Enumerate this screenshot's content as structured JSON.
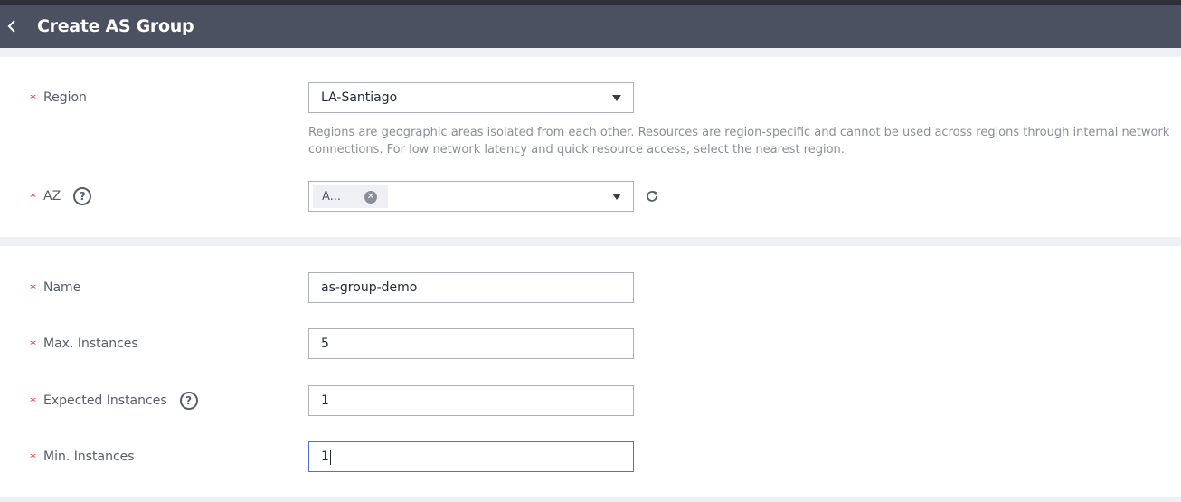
{
  "header": {
    "title": "Create AS Group"
  },
  "region": {
    "label": "Region",
    "value": "LA-Santiago",
    "hint": "Regions are geographic areas isolated from each other. Resources are region-specific and cannot be used across regions through internal network connections. For low network latency and quick resource access, select the nearest region."
  },
  "az": {
    "label": "AZ",
    "tag": "A..."
  },
  "name": {
    "label": "Name",
    "value": "as-group-demo"
  },
  "max_instances": {
    "label": "Max. Instances",
    "value": "5"
  },
  "expected_instances": {
    "label": "Expected Instances",
    "value": "1"
  },
  "min_instances": {
    "label": "Min. Instances",
    "value": "1"
  },
  "required_mark": "*",
  "help_glyph": "?",
  "colors": {
    "header_bg": "#4b5160",
    "required": "#e3212d",
    "focus_border": "#526ecc"
  }
}
